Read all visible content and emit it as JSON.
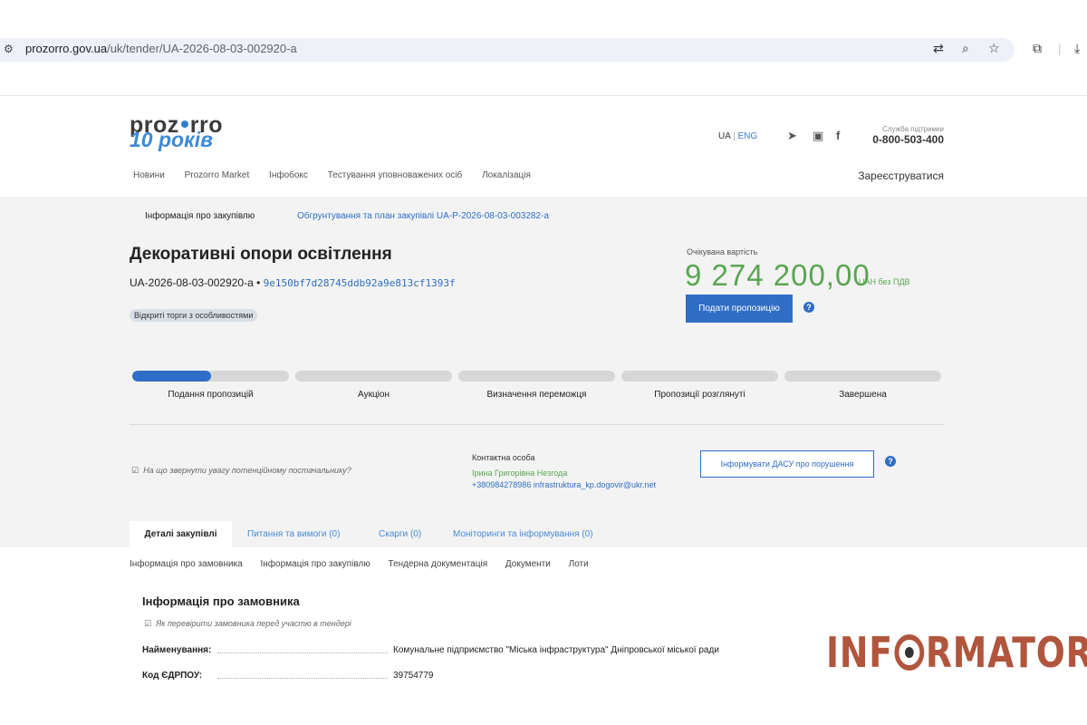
{
  "browser": {
    "url_domain": "prozorro.gov.ua",
    "url_path": "/uk/tender/UA-2026-08-03-002920-a"
  },
  "header": {
    "logo_top_left": "proz",
    "logo_top_right": "rro",
    "logo_bottom": "10 років",
    "lang_ua": "UA",
    "lang_sep": "|",
    "lang_eng": "ENG",
    "support_label": "Служба підтримки",
    "support_phone": "0-800-503-400",
    "nav": [
      "Новини",
      "Prozorro Market",
      "Інфобокс",
      "Тестування уповноважених осіб",
      "Локалізація"
    ],
    "register": "Зареєструватися"
  },
  "tender": {
    "subtab_info": "Інформація про закупівлю",
    "subtab_plan": "Обгрунтування та план закупівлі UA-P-2026-08-03-003282-a",
    "title": "Декоративні опори освітлення",
    "id": "UA-2026-08-03-002920-a",
    "id_sep": "•",
    "hash": "9e150bf7d28745ddb92a9e813cf1393f",
    "badge": "Відкриті торги з особливостями",
    "price_label": "Очікувана вартість",
    "price": "9 274 200,00",
    "price_unit": "UAH без ПДВ",
    "submit_label": "Подати пропозицію",
    "help_glyph": "?"
  },
  "progress": {
    "steps": [
      "Подання пропозицій",
      "Аукціон",
      "Визначення переможця",
      "Пропозиції розглянуті",
      "Завершена"
    ],
    "current_step_fill": 0.5
  },
  "contact": {
    "hint": "На що звернути увагу потенційному постачальнику?",
    "label": "Контактна особа",
    "name": "Ірина Григорівна Незгода",
    "phone_email": "+380984278986 infrastruktura_kp.dogovir@ukr.net",
    "dasu_label": "Інформувати ДАСУ про порушення"
  },
  "tabs": {
    "active": "Деталі закупівлі",
    "items": [
      "Питання та вимоги (0)",
      "Скарги (0)",
      "Моніторинги та інформування (0)"
    ]
  },
  "sections_nav": [
    "Інформація про замовника",
    "Інформація про закупівлю",
    "Тендерна документація",
    "Документи",
    "Лоти"
  ],
  "customer": {
    "title": "Інформація про замовника",
    "check_hint": "Як перевірити замовника перед участю в тендері",
    "name_label": "Найменування:",
    "name_value": "Комунальне підприємство \"Міська інфраструктура\" Дніпровської міської ради",
    "edrpou_label": "Код ЄДРПОУ:",
    "edrpou_value": "39754779"
  },
  "watermark": {
    "left": "INF",
    "right": "RMATOR"
  },
  "colors": {
    "accent_blue": "#2f6dc6",
    "price_green": "#5aa552",
    "watermark": "#b1553d"
  }
}
